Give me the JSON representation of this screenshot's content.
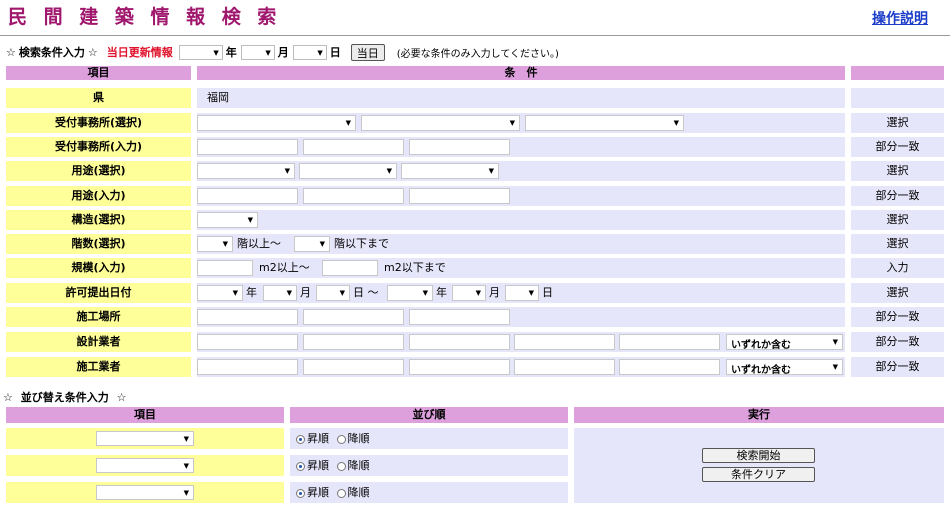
{
  "page": {
    "title": "民 間 建 築 情 報 検 索",
    "help_link": "操作説明"
  },
  "condition_header": {
    "star": "☆",
    "label": "検索条件入力",
    "updated": "当日更新情報",
    "year": "年",
    "month": "月",
    "day": "日",
    "today_button": "当日",
    "note": "(必要な条件のみ入力してください。)"
  },
  "table_head": {
    "item": "項目",
    "condition": "条　件",
    "option": ""
  },
  "rows": {
    "pref": {
      "label": "県",
      "value": "福岡",
      "option": ""
    },
    "office_select": {
      "label": "受付事務所(選択)",
      "option": "選択"
    },
    "office_input": {
      "label": "受付事務所(入力)",
      "option": "部分一致"
    },
    "use_select": {
      "label": "用途(選択)",
      "option": "選択"
    },
    "use_input": {
      "label": "用途(入力)",
      "option": "部分一致"
    },
    "struct_select": {
      "label": "構造(選択)",
      "option": "選択"
    },
    "floors_select": {
      "label": "階数(選択)",
      "from": "階以上～",
      "to": "階以下まで",
      "option": "選択"
    },
    "scale_input": {
      "label": "規模(入力)",
      "from": "m2以上～",
      "to": "m2以下まで",
      "option": "入力"
    },
    "permit_date": {
      "label": "許可提出日付",
      "year": "年",
      "month": "月",
      "day_tilde": "日 ～",
      "day": "日",
      "option": "選択"
    },
    "site": {
      "label": "施工場所",
      "option": "部分一致"
    },
    "designer": {
      "label": "設計業者",
      "match": "いずれか含む",
      "option": "部分一致"
    },
    "builder": {
      "label": "施工業者",
      "match": "いずれか含む",
      "option": "部分一致"
    }
  },
  "sort": {
    "header": "並び替え条件入力",
    "col_item": "項目",
    "col_order": "並び順",
    "col_exec": "実行",
    "asc": "昇順",
    "desc": "降順"
  },
  "exec": {
    "search_button": "検索開始",
    "clear_button": "条件クリア"
  },
  "colors": {
    "title": "#a0186e",
    "label_bg": "#ffff99",
    "value_bg": "#e6e6fa",
    "header_bg": "#dda0dd",
    "accent_red": "#e0102a",
    "link": "#1a3cc8"
  }
}
